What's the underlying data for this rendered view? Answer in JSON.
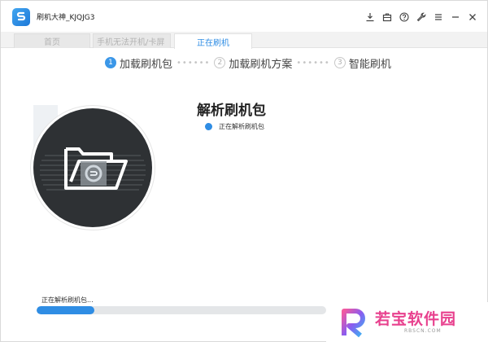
{
  "titlebar": {
    "title": "刷机大神_KJQJG3",
    "controls": [
      "download-icon",
      "toolbox-icon",
      "help-icon",
      "wrench-icon",
      "menu-icon",
      "minimize-icon",
      "close-icon"
    ]
  },
  "tabs": [
    {
      "label": "首页",
      "active": false
    },
    {
      "label": "手机无法开机/卡屏",
      "active": false
    },
    {
      "label": "正在刷机",
      "active": true
    }
  ],
  "steps": [
    {
      "num": "1",
      "label": "加载刷机包",
      "active": true
    },
    {
      "num": "2",
      "label": "加载刷机方案",
      "active": false
    },
    {
      "num": "3",
      "label": "智能刷机",
      "active": false
    }
  ],
  "main": {
    "heading": "解析刷机包",
    "status": "正在解析刷机包"
  },
  "progress": {
    "label": "正在解析刷机包...",
    "percent": 20
  },
  "watermark": {
    "brand": "若宝软件园",
    "url": "RBSCN.COM"
  },
  "colors": {
    "accent": "#2f8de4",
    "disc": "#2e3134",
    "watermark": "#e8418e"
  }
}
